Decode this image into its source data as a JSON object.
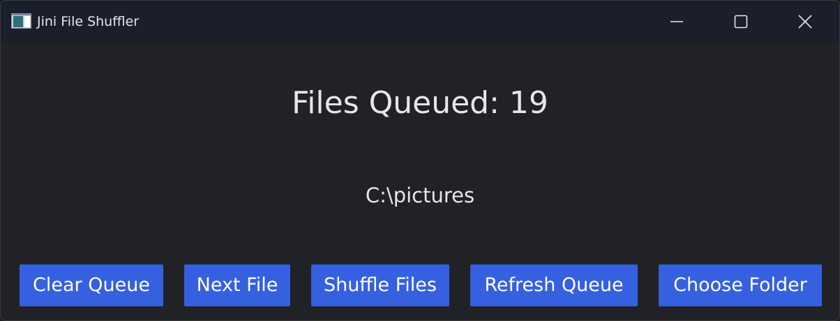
{
  "window": {
    "title": "Jini File Shuffler",
    "app_icon": "app-window-icon",
    "controls": {
      "minimize_icon": "minimize-icon",
      "maximize_icon": "maximize-icon",
      "close_icon": "close-icon"
    }
  },
  "main": {
    "files_queued": "Files Queued: 19",
    "folder_path": "C:\\pictures"
  },
  "buttons": {
    "clear_queue": "Clear Queue",
    "next_file": "Next File",
    "shuffle_files": "Shuffle Files",
    "refresh_queue": "Refresh Queue",
    "choose_folder": "Choose Folder"
  },
  "colors": {
    "titlebar": "#1b1f2c",
    "background": "#212226",
    "button": "#3560e0",
    "text": "#e7e7e9"
  }
}
